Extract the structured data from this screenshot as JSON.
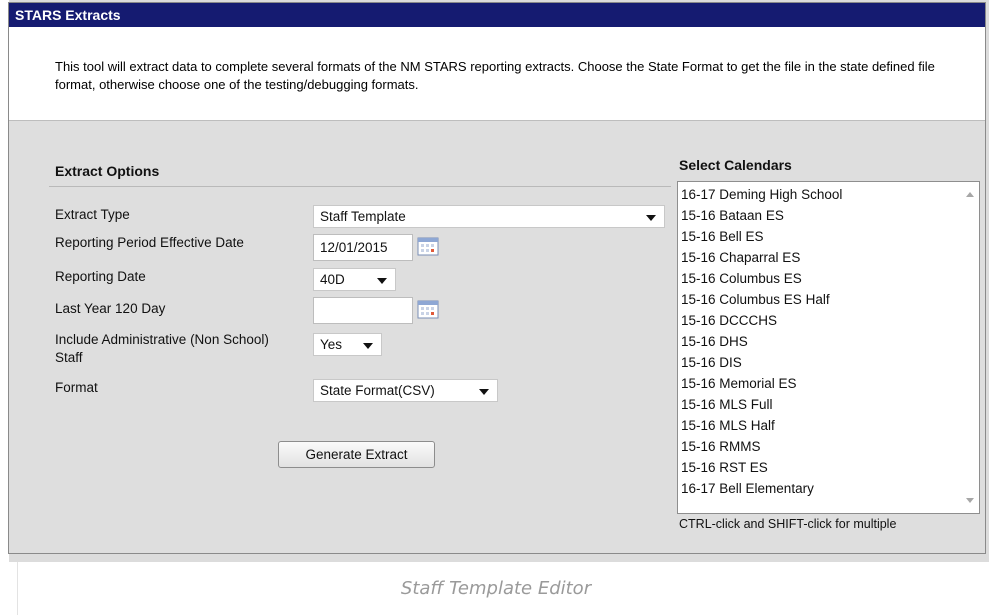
{
  "window": {
    "title": "STARS Extracts",
    "description": "This tool will extract data to complete several formats of the NM STARS reporting extracts. Choose the State Format to get the file in the state defined file format, otherwise choose one of the testing/debugging formats."
  },
  "options": {
    "section_title": "Extract Options",
    "extract_type": {
      "label": "Extract Type",
      "value": "Staff Template"
    },
    "reporting_period_effective_date": {
      "label": "Reporting Period Effective Date",
      "value": "12/01/2015"
    },
    "reporting_date": {
      "label": "Reporting Date",
      "value": "40D"
    },
    "last_year_120_day": {
      "label": "Last Year 120 Day",
      "value": ""
    },
    "include_admin_staff": {
      "label": "Include Administrative (Non School) Staff",
      "value": "Yes"
    },
    "format": {
      "label": "Format",
      "value": "State Format(CSV)"
    },
    "generate_button": "Generate Extract"
  },
  "calendars": {
    "title": "Select Calendars",
    "items": [
      "16-17 Deming High School",
      "15-16 Bataan ES",
      "15-16 Bell ES",
      "15-16 Chaparral ES",
      "15-16 Columbus ES",
      "15-16 Columbus ES Half",
      "15-16 DCCCHS",
      "15-16 DHS",
      "15-16 DIS",
      "15-16 Memorial ES",
      "15-16 MLS Full",
      "15-16 MLS Half",
      "15-16 RMMS",
      "15-16 RST ES",
      "16-17 Bell Elementary"
    ],
    "hint": "CTRL-click and SHIFT-click for multiple"
  },
  "caption": "Staff Template Editor",
  "colors": {
    "title_bar": "#151b71",
    "panel_bg": "#dedede"
  }
}
